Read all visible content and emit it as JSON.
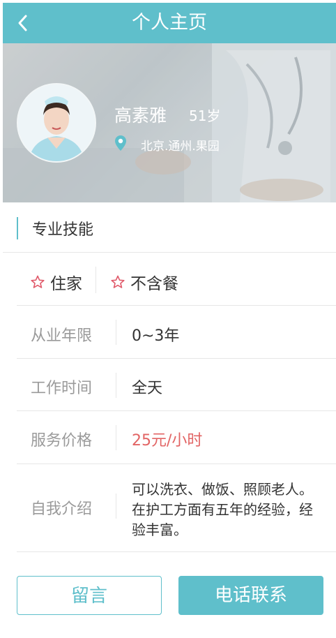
{
  "header": {
    "title": "个人主页",
    "back_icon": "chevron-left-icon"
  },
  "profile": {
    "name": "高素雅",
    "age": "51岁",
    "location": "北京.通州.果园",
    "location_icon": "map-pin-icon"
  },
  "skills": {
    "title": "专业技能",
    "tags": [
      {
        "icon": "star-outline-icon",
        "label": "住家"
      },
      {
        "icon": "star-outline-icon",
        "label": "不含餐"
      }
    ]
  },
  "details": {
    "experience": {
      "label": "从业年限",
      "value": "0~3年"
    },
    "work_time": {
      "label": "工作时间",
      "value": "全天"
    },
    "price": {
      "label": "服务价格",
      "value": "25元/小时"
    },
    "intro": {
      "label": "自我介绍",
      "value": "可以洗衣、做饭、照顾老人。在护工方面有五年的经验，经验丰富。"
    }
  },
  "actions": {
    "message_label": "留言",
    "call_label": "电话联系"
  },
  "colors": {
    "accent": "#5fbfcb",
    "price": "#e26464",
    "star": "#e05a6a"
  }
}
